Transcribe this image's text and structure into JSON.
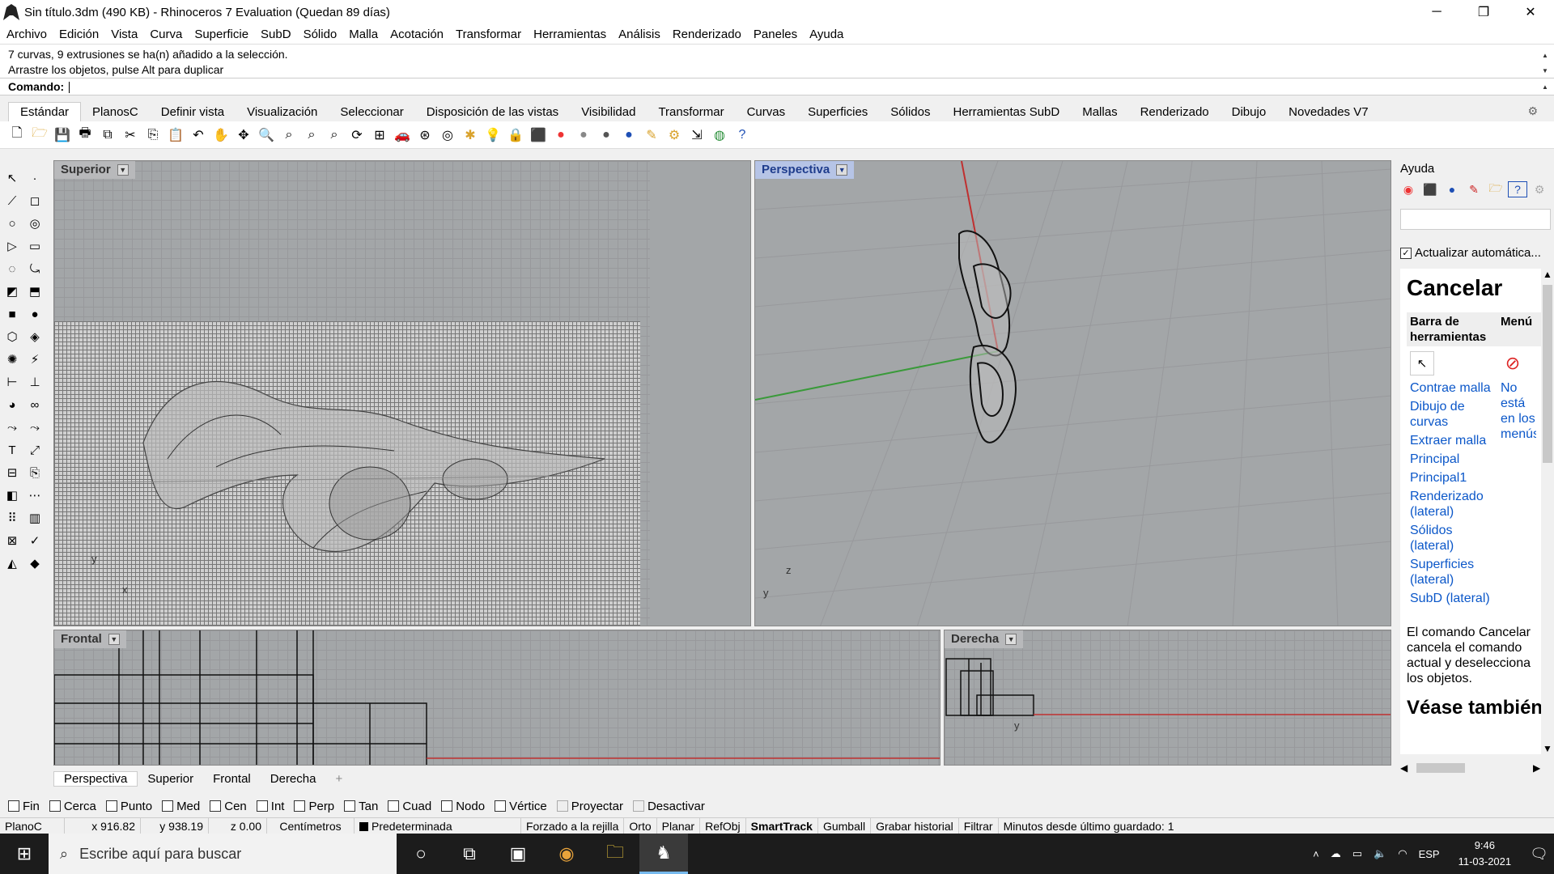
{
  "window": {
    "title": "Sin título.3dm (490 KB) - Rhinoceros 7 Evaluation (Quedan 89 días)",
    "minimize": "─",
    "restore": "❐",
    "close": "✕"
  },
  "menu": [
    "Archivo",
    "Edición",
    "Vista",
    "Curva",
    "Superficie",
    "SubD",
    "Sólido",
    "Malla",
    "Acotación",
    "Transformar",
    "Herramientas",
    "Análisis",
    "Renderizado",
    "Paneles",
    "Ayuda"
  ],
  "command": {
    "history": [
      "7 curvas, 9 extrusiones se ha(n) añadido a la selección.",
      "Arrastre los objetos, pulse Alt para duplicar"
    ],
    "prompt": "Comando:"
  },
  "toolbar_tabs": [
    "Estándar",
    "PlanosC",
    "Definir vista",
    "Visualización",
    "Seleccionar",
    "Disposición de las vistas",
    "Visibilidad",
    "Transformar",
    "Curvas",
    "Superficies",
    "Sólidos",
    "Herramientas SubD",
    "Mallas",
    "Renderizado",
    "Dibujo",
    "Novedades V7"
  ],
  "toolbar_icons": [
    "new-file-icon",
    "open-icon",
    "save-icon",
    "print-icon",
    "import-icon",
    "cut-icon",
    "copy-icon",
    "paste-icon",
    "undo-icon",
    "pan-icon",
    "rotate-view-icon",
    "zoom-icon",
    "zoom-window-icon",
    "zoom-extents-icon",
    "zoom-selected-icon",
    "rotate-icon",
    "four-views-icon",
    "snap-icon",
    "car-icon",
    "sphere-target-icon",
    "gumball-icon",
    "light-icon",
    "lock-icon",
    "material-icon",
    "color-wheel-icon",
    "shade-icon",
    "render-icon",
    "rendered-sphere-icon",
    "text-icon",
    "settings-icon",
    "gumball-move-icon",
    "world-icon",
    "help-icon"
  ],
  "viewports": {
    "top": {
      "label": "Superior"
    },
    "perspective": {
      "label": "Perspectiva"
    },
    "front": {
      "label": "Frontal"
    },
    "right": {
      "label": "Derecha"
    }
  },
  "axis_labels": {
    "x": "x",
    "y": "y",
    "z": "z"
  },
  "viewport_tabs": [
    "Perspectiva",
    "Superior",
    "Frontal",
    "Derecha"
  ],
  "osnaps": [
    {
      "label": "Fin",
      "checked": false
    },
    {
      "label": "Cerca",
      "checked": false
    },
    {
      "label": "Punto",
      "checked": false
    },
    {
      "label": "Med",
      "checked": false
    },
    {
      "label": "Cen",
      "checked": false
    },
    {
      "label": "Int",
      "checked": false
    },
    {
      "label": "Perp",
      "checked": false
    },
    {
      "label": "Tan",
      "checked": false
    },
    {
      "label": "Cuad",
      "checked": false
    },
    {
      "label": "Nodo",
      "checked": false
    },
    {
      "label": "Vértice",
      "checked": false
    },
    {
      "label": "Proyectar",
      "checked": false,
      "dim": true
    },
    {
      "label": "Desactivar",
      "checked": false,
      "dim": true
    }
  ],
  "status": {
    "cplane": "PlanoC",
    "x": "x 916.82",
    "y": "y 938.19",
    "z": "z 0.00",
    "units": "Centímetros",
    "layer": "Predeterminada",
    "items": [
      "Forzado a la rejilla",
      "Orto",
      "Planar",
      "RefObj",
      "SmartTrack",
      "Gumball",
      "Grabar historial",
      "Filtrar"
    ],
    "active_item": "SmartTrack",
    "minutes": "Minutos desde último guardado: 1"
  },
  "right_panel": {
    "title": "Ayuda",
    "icons": [
      "color-icon",
      "material-icon",
      "environment-icon",
      "texture-icon",
      "folder-icon",
      "help-panel-icon",
      "settings-icon"
    ],
    "auto_update": "Actualizar automática...",
    "auto_update_checked": true,
    "help_title": "Cancelar",
    "col_toolbar": "Barra de herramientas",
    "col_menu": "Menú",
    "toolbar_links": [
      "Contrae malla",
      "Dibujo de curvas",
      "Extraer malla",
      "Principal",
      "Principal1",
      "Renderizado (lateral)",
      "Sólidos (lateral)",
      "Superficies (lateral)",
      "SubD (lateral)"
    ],
    "menu_note": "No está en los menús",
    "description": "El comando Cancelar cancela el comando actual y deselecciona los objetos.",
    "see_also": "Véase también"
  },
  "taskbar": {
    "search_placeholder": "Escribe aquí para buscar",
    "language": "ESP",
    "time": "9:46",
    "date": "11-03-2021"
  }
}
